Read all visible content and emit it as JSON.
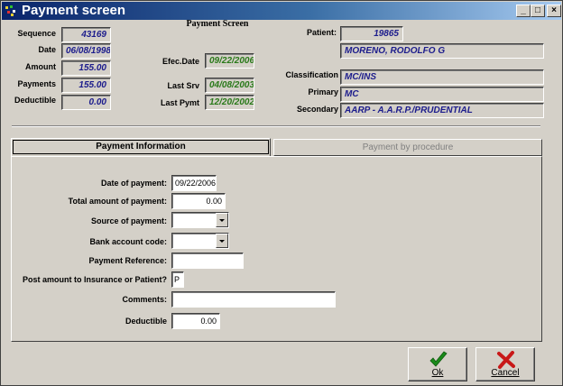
{
  "window": {
    "title": "Payment screen"
  },
  "header": {
    "center_title": "Payment Screen",
    "sequence": {
      "label": "Sequence",
      "value": "43169"
    },
    "date": {
      "label": "Date",
      "value": "06/08/1998"
    },
    "amount": {
      "label": "Amount",
      "value": "155.00"
    },
    "payments": {
      "label": "Payments",
      "value": "155.00"
    },
    "deductible": {
      "label": "Deductible",
      "value": "0.00"
    },
    "efec_date": {
      "label": "Efec.Date",
      "value": "09/22/2006"
    },
    "last_srv": {
      "label": "Last Srv",
      "value": "04/08/2003"
    },
    "last_pymt": {
      "label": "Last Pymt",
      "value": "12/20/2002"
    },
    "patient": {
      "label": "Patient:",
      "id": "19865",
      "name": "MORENO, RODOLFO G"
    },
    "classification": {
      "label": "Classification",
      "value": "MC/INS"
    },
    "primary": {
      "label": "Primary",
      "value": "MC"
    },
    "secondary": {
      "label": "Secondary",
      "value": "AARP - A.A.R.P./PRUDENTIAL"
    }
  },
  "tabs": [
    {
      "label": "Payment Information",
      "active": true
    },
    {
      "label": "Payment  by procedure",
      "active": false
    }
  ],
  "form": {
    "date_of_payment": {
      "label": "Date of payment:",
      "value": "09/22/2006"
    },
    "total_amount": {
      "label": "Total amount of payment:",
      "value": "0.00"
    },
    "source": {
      "label": "Source of payment:",
      "value": ""
    },
    "bank_account": {
      "label": "Bank account code:",
      "value": ""
    },
    "payment_reference": {
      "label": "Payment Reference:",
      "value": ""
    },
    "post_amount": {
      "label": "Post amount to Insurance or Patient?",
      "value": "P"
    },
    "comments": {
      "label": "Comments:",
      "value": ""
    },
    "deductible": {
      "label": "Deductible",
      "value": "0.00"
    }
  },
  "buttons": {
    "ok": {
      "label": "Ok",
      "icon": "checkmark-icon",
      "color": "#1a8a1a"
    },
    "cancel": {
      "label": "Cancel",
      "icon": "x-mark-icon",
      "color": "#c81818"
    }
  }
}
